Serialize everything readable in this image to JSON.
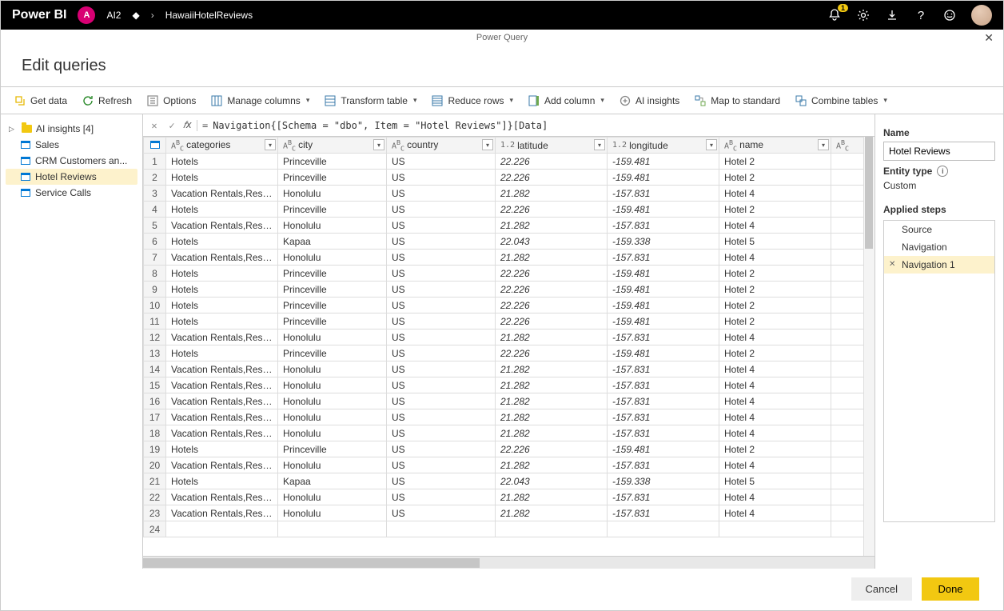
{
  "topbar": {
    "brand": "Power BI",
    "workspaceInitial": "A",
    "workspaceName": "AI2",
    "fileName": "HawaiiHotelReviews",
    "notifCount": "1"
  },
  "dialog": {
    "subtitle": "Power Query",
    "title": "Edit queries"
  },
  "ribbon": {
    "getData": "Get data",
    "refresh": "Refresh",
    "options": "Options",
    "manageColumns": "Manage columns",
    "transformTable": "Transform table",
    "reduceRows": "Reduce rows",
    "addColumn": "Add column",
    "aiInsights": "AI insights",
    "mapToStandard": "Map to standard",
    "combineTables": "Combine tables"
  },
  "queries": {
    "group": "AI insights [4]",
    "items": [
      "Sales",
      "CRM Customers an...",
      "Hotel Reviews",
      "Service Calls"
    ]
  },
  "formula": "Navigation{[Schema = \"dbo\", Item = \"Hotel Reviews\"]}[Data]",
  "columns": [
    {
      "name": "categories",
      "type": "ABC"
    },
    {
      "name": "city",
      "type": "ABC"
    },
    {
      "name": "country",
      "type": "ABC"
    },
    {
      "name": "latitude",
      "type": "1.2"
    },
    {
      "name": "longitude",
      "type": "1.2"
    },
    {
      "name": "name",
      "type": "ABC"
    }
  ],
  "rows": [
    {
      "n": 1,
      "categories": "Hotels",
      "city": "Princeville",
      "country": "US",
      "latitude": "22.226",
      "longitude": "-159.481",
      "name": "Hotel 2"
    },
    {
      "n": 2,
      "categories": "Hotels",
      "city": "Princeville",
      "country": "US",
      "latitude": "22.226",
      "longitude": "-159.481",
      "name": "Hotel 2"
    },
    {
      "n": 3,
      "categories": "Vacation Rentals,Resorts &...",
      "city": "Honolulu",
      "country": "US",
      "latitude": "21.282",
      "longitude": "-157.831",
      "name": "Hotel 4"
    },
    {
      "n": 4,
      "categories": "Hotels",
      "city": "Princeville",
      "country": "US",
      "latitude": "22.226",
      "longitude": "-159.481",
      "name": "Hotel 2"
    },
    {
      "n": 5,
      "categories": "Vacation Rentals,Resorts &...",
      "city": "Honolulu",
      "country": "US",
      "latitude": "21.282",
      "longitude": "-157.831",
      "name": "Hotel 4"
    },
    {
      "n": 6,
      "categories": "Hotels",
      "city": "Kapaa",
      "country": "US",
      "latitude": "22.043",
      "longitude": "-159.338",
      "name": "Hotel 5"
    },
    {
      "n": 7,
      "categories": "Vacation Rentals,Resorts &...",
      "city": "Honolulu",
      "country": "US",
      "latitude": "21.282",
      "longitude": "-157.831",
      "name": "Hotel 4"
    },
    {
      "n": 8,
      "categories": "Hotels",
      "city": "Princeville",
      "country": "US",
      "latitude": "22.226",
      "longitude": "-159.481",
      "name": "Hotel 2"
    },
    {
      "n": 9,
      "categories": "Hotels",
      "city": "Princeville",
      "country": "US",
      "latitude": "22.226",
      "longitude": "-159.481",
      "name": "Hotel 2"
    },
    {
      "n": 10,
      "categories": "Hotels",
      "city": "Princeville",
      "country": "US",
      "latitude": "22.226",
      "longitude": "-159.481",
      "name": "Hotel 2"
    },
    {
      "n": 11,
      "categories": "Hotels",
      "city": "Princeville",
      "country": "US",
      "latitude": "22.226",
      "longitude": "-159.481",
      "name": "Hotel 2"
    },
    {
      "n": 12,
      "categories": "Vacation Rentals,Resorts &...",
      "city": "Honolulu",
      "country": "US",
      "latitude": "21.282",
      "longitude": "-157.831",
      "name": "Hotel 4"
    },
    {
      "n": 13,
      "categories": "Hotels",
      "city": "Princeville",
      "country": "US",
      "latitude": "22.226",
      "longitude": "-159.481",
      "name": "Hotel 2"
    },
    {
      "n": 14,
      "categories": "Vacation Rentals,Resorts &...",
      "city": "Honolulu",
      "country": "US",
      "latitude": "21.282",
      "longitude": "-157.831",
      "name": "Hotel 4"
    },
    {
      "n": 15,
      "categories": "Vacation Rentals,Resorts &...",
      "city": "Honolulu",
      "country": "US",
      "latitude": "21.282",
      "longitude": "-157.831",
      "name": "Hotel 4"
    },
    {
      "n": 16,
      "categories": "Vacation Rentals,Resorts &...",
      "city": "Honolulu",
      "country": "US",
      "latitude": "21.282",
      "longitude": "-157.831",
      "name": "Hotel 4"
    },
    {
      "n": 17,
      "categories": "Vacation Rentals,Resorts &...",
      "city": "Honolulu",
      "country": "US",
      "latitude": "21.282",
      "longitude": "-157.831",
      "name": "Hotel 4"
    },
    {
      "n": 18,
      "categories": "Vacation Rentals,Resorts &...",
      "city": "Honolulu",
      "country": "US",
      "latitude": "21.282",
      "longitude": "-157.831",
      "name": "Hotel 4"
    },
    {
      "n": 19,
      "categories": "Hotels",
      "city": "Princeville",
      "country": "US",
      "latitude": "22.226",
      "longitude": "-159.481",
      "name": "Hotel 2"
    },
    {
      "n": 20,
      "categories": "Vacation Rentals,Resorts &...",
      "city": "Honolulu",
      "country": "US",
      "latitude": "21.282",
      "longitude": "-157.831",
      "name": "Hotel 4"
    },
    {
      "n": 21,
      "categories": "Hotels",
      "city": "Kapaa",
      "country": "US",
      "latitude": "22.043",
      "longitude": "-159.338",
      "name": "Hotel 5"
    },
    {
      "n": 22,
      "categories": "Vacation Rentals,Resorts &...",
      "city": "Honolulu",
      "country": "US",
      "latitude": "21.282",
      "longitude": "-157.831",
      "name": "Hotel 4"
    },
    {
      "n": 23,
      "categories": "Vacation Rentals,Resorts &...",
      "city": "Honolulu",
      "country": "US",
      "latitude": "21.282",
      "longitude": "-157.831",
      "name": "Hotel 4"
    },
    {
      "n": 24,
      "categories": "",
      "city": "",
      "country": "",
      "latitude": "",
      "longitude": "",
      "name": ""
    }
  ],
  "settings": {
    "nameLabel": "Name",
    "nameValue": "Hotel Reviews",
    "entityTypeLabel": "Entity type",
    "entityTypeValue": "Custom",
    "appliedStepsLabel": "Applied steps",
    "steps": [
      "Source",
      "Navigation",
      "Navigation 1"
    ]
  },
  "footer": {
    "cancel": "Cancel",
    "done": "Done"
  }
}
